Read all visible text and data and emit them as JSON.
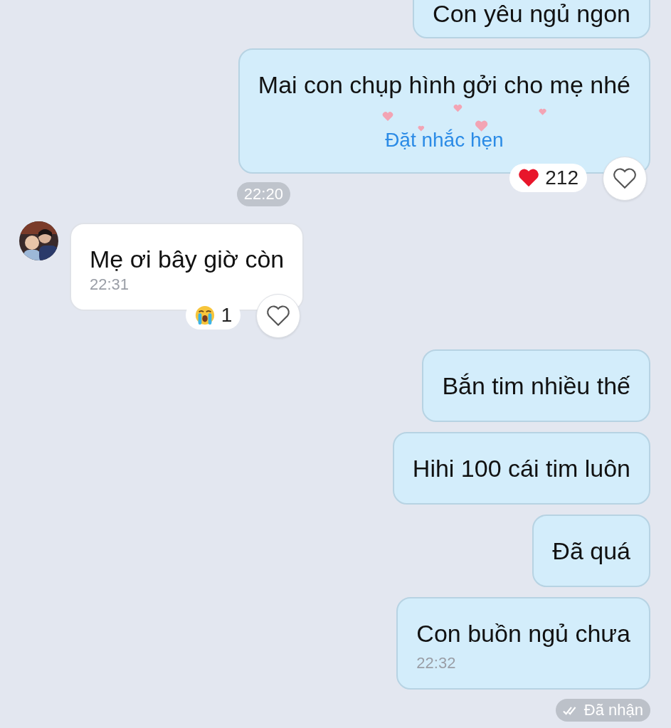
{
  "messages": [
    {
      "kind": "outgoing",
      "text": "Con yêu ngủ ngon"
    },
    {
      "kind": "outgoing",
      "text": "Mai con chụp hình gởi cho mẹ nhé",
      "link": "Đặt nhắc hẹn",
      "reaction": {
        "kind": "heart",
        "count": "212"
      },
      "liked": false,
      "chip_time": "22:20"
    },
    {
      "kind": "incoming",
      "text": "Mẹ ơi bây giờ còn",
      "time": "22:31",
      "reaction": {
        "kind": "cry",
        "count": "1"
      },
      "liked": false
    },
    {
      "kind": "outgoing",
      "text": "Bắn tim nhiều thế"
    },
    {
      "kind": "outgoing",
      "text": "Hihi 100 cái tim luôn"
    },
    {
      "kind": "outgoing",
      "text": "Đã quá"
    },
    {
      "kind": "outgoing",
      "text": "Con buồn ngủ chưa",
      "time": "22:32"
    }
  ],
  "status": {
    "text": "Đã nhận"
  }
}
